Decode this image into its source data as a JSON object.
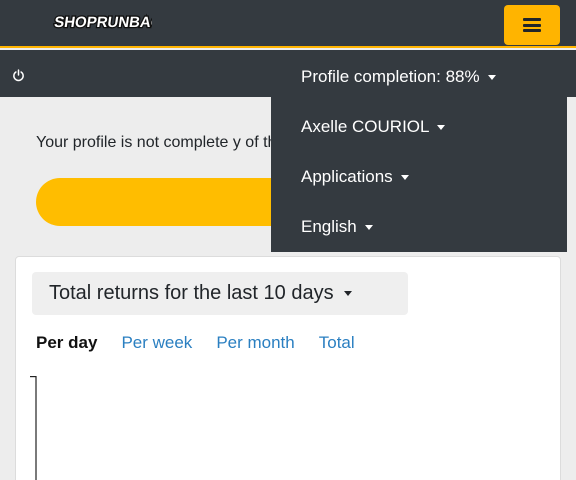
{
  "header": {
    "logo_text": "SHOPRUNBACK",
    "menu_icon": "hamburger-icon",
    "accent": "#ffb400",
    "background": "#343a40"
  },
  "subbar": {
    "power_icon": "power-icon"
  },
  "notice": {
    "text": "Your profile is not complete y of that."
  },
  "dropdown": {
    "items": [
      {
        "label": "Profile completion: 88%"
      },
      {
        "label": "Axelle COURIOL"
      },
      {
        "label": "Applications"
      },
      {
        "label": "English"
      }
    ]
  },
  "stats": {
    "period_select": "Total returns for the last 10 days",
    "tabs": [
      {
        "label": "Per day",
        "active": true
      },
      {
        "label": "Per week",
        "active": false
      },
      {
        "label": "Per month",
        "active": false
      },
      {
        "label": "Total",
        "active": false
      }
    ]
  }
}
